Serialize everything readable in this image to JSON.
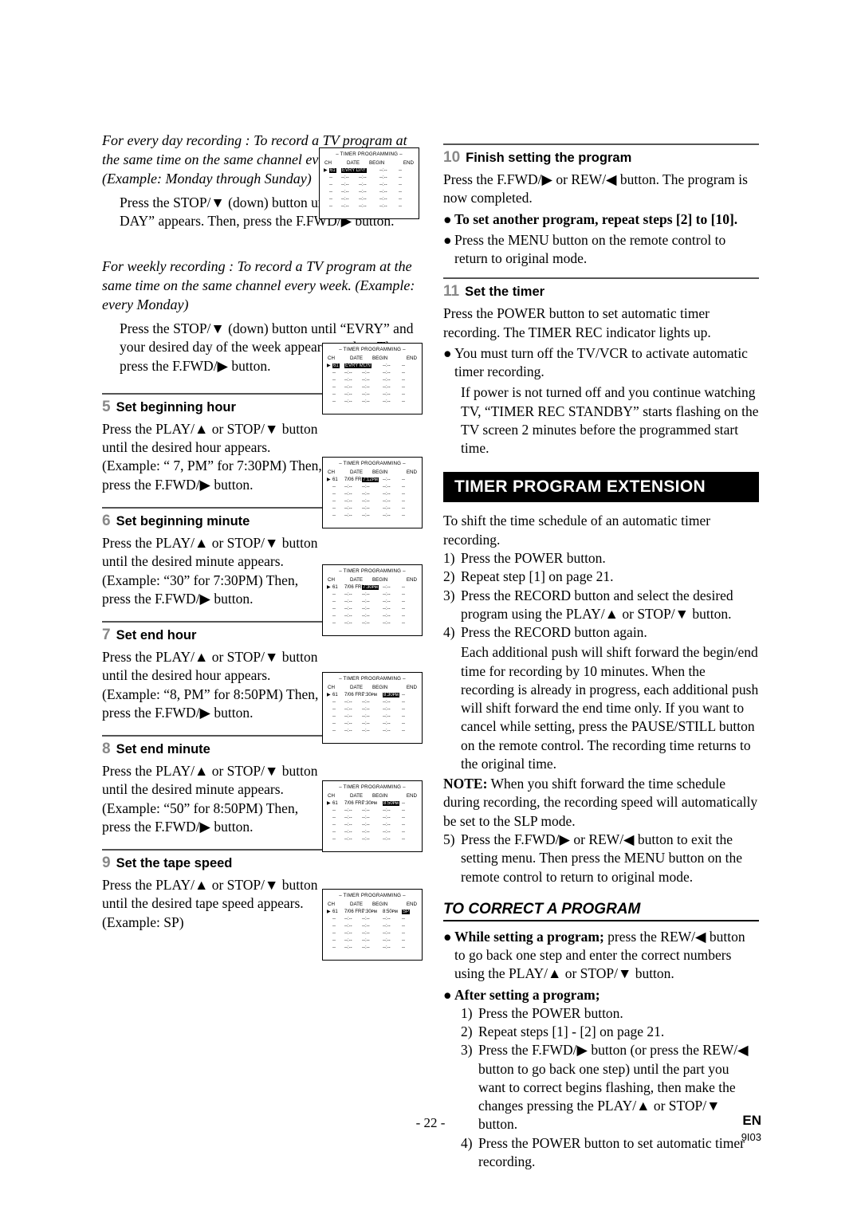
{
  "page": {
    "number": "- 22 -",
    "lang": "EN",
    "code": "9I03"
  },
  "left_column": {
    "everyday": {
      "heading_italic": "For every day recording : To record a TV program at the same time on the same channel every day. (Example: Monday through Sunday)",
      "body": "Press the STOP/▼ (down) button until “EVRY DAY” appears. Then, press the F.FWD/▶ button."
    },
    "weekly": {
      "heading_italic": "For weekly recording : To record a TV program at the same time on the same channel every week. (Example: every Monday)",
      "body": "Press the STOP/▼ (down) button until “EVRY” and your desired day of the week appear together. Then, press the F.FWD/▶ button."
    },
    "steps": [
      {
        "num": "5",
        "label": "Set beginning hour",
        "body": "Press the PLAY/▲ or STOP/▼ button until the desired hour appears. (Example: “ 7, PM” for 7:30PM) Then, press the F.FWD/▶ button."
      },
      {
        "num": "6",
        "label": "Set beginning minute",
        "body": "Press the PLAY/▲ or STOP/▼ button until the desired minute appears. (Example: “30” for 7:30PM) Then, press the F.FWD/▶ button."
      },
      {
        "num": "7",
        "label": "Set end hour",
        "body": "Press the PLAY/▲ or STOP/▼ button until the desired hour appears. (Example: “8, PM” for 8:50PM) Then, press the F.FWD/▶ button."
      },
      {
        "num": "8",
        "label": "Set end minute",
        "body": "Press the PLAY/▲ or STOP/▼ button until the desired minute appears. (Example: “50” for 8:50PM) Then, press the F.FWD/▶ button."
      },
      {
        "num": "9",
        "label": "Set the tape speed",
        "body": "Press the PLAY/▲ or STOP/▼ button until the desired tape speed appears. (Example: SP)"
      }
    ]
  },
  "osd_screens": {
    "title": "– TIMER PROGRAMMING –",
    "headers": [
      "CH",
      "DATE",
      "BEGIN",
      "END"
    ],
    "rows": [
      {
        "id": "everyday",
        "ch": "61",
        "date": "EVRY DAY",
        "begin": "--:--",
        "end": "--:--",
        "sp": "--"
      },
      {
        "id": "weekly",
        "ch": "61",
        "date": "EVRY MON",
        "begin": "--:--",
        "end": "--:--",
        "sp": "--"
      },
      {
        "id": "begin_hour",
        "ch": "61",
        "date": "7/06  FRI",
        "begin": "7:12ᴘᴍ",
        "end": "--:--",
        "sp": "--"
      },
      {
        "id": "begin_min",
        "ch": "61",
        "date": "7/06  FRI",
        "begin": "7:30ᴘᴍ",
        "end": "--:--",
        "sp": "--"
      },
      {
        "id": "end_hour",
        "ch": "61",
        "date": "7/06  FRI",
        "begin": "7:30ᴘᴍ",
        "end": "8:30ᴘᴍ",
        "sp": "--"
      },
      {
        "id": "end_min",
        "ch": "61",
        "date": "7/06  FRI",
        "begin": "7:30ᴘᴍ",
        "end": "8:50ᴘᴍ",
        "sp": "--"
      },
      {
        "id": "tape_speed",
        "ch": "61",
        "date": "7/06  FRI",
        "begin": "7:30ᴘᴍ",
        "end": "8:50ᴘᴍ",
        "sp": "SP"
      }
    ],
    "empty_cell": "--:--",
    "empty_short": "--"
  },
  "right_column": {
    "step10": {
      "num": "10",
      "label": "Finish setting the program",
      "body": "Press the F.FWD/▶ or REW/◀ button. The program is now completed.",
      "bullets": [
        {
          "bold": true,
          "text": "To set another program, repeat steps [2] to [10]."
        },
        {
          "bold": false,
          "text": "Press the MENU button on the remote control to return to original mode."
        }
      ]
    },
    "step11": {
      "num": "11",
      "label": "Set the timer",
      "body": "Press the POWER button to set automatic timer recording. The TIMER REC indicator lights up.",
      "bullets": [
        {
          "bold": false,
          "text": "You must turn off the TV/VCR to activate automatic timer recording."
        }
      ],
      "note": "If power is not turned off and you continue watching TV, “TIMER REC STANDBY” starts flashing on the TV screen 2 minutes before the programmed start time."
    },
    "timer_extension": {
      "title": "TIMER PROGRAM EXTENSION",
      "intro": "To shift the time schedule of an automatic timer recording.",
      "steps": [
        {
          "n": "1)",
          "t": "Press the POWER button."
        },
        {
          "n": "2)",
          "t": "Repeat step [1] on page 21."
        },
        {
          "n": "3)",
          "t": "Press the RECORD button and select the desired program using the PLAY/▲ or STOP/▼ button."
        },
        {
          "n": "4)",
          "t": "Press the RECORD button again."
        }
      ],
      "paragraph": "Each additional push will shift forward the begin/end time for recording by 10 minutes. When the recording is already in progress, each additional push will shift forward the end time only. If you want to cancel while setting, press the PAUSE/STILL button on the remote control. The recording time returns to the original time.",
      "note_label": "NOTE:",
      "note_text": " When you shift forward the time schedule during recording, the recording speed will automatically be set to the SLP mode.",
      "step5": {
        "n": "5)",
        "t": "Press the F.FWD/▶ or REW/◀ button to exit the setting menu. Then press the MENU button on the remote control to return to original mode."
      }
    },
    "correct_program": {
      "title": "TO CORRECT A PROGRAM",
      "bullet1_bold": "While setting a program;",
      "bullet1_rest": " press the REW/◀ button to go back one step and enter the correct numbers using the PLAY/▲ or STOP/▼ button.",
      "bullet2_bold": "After setting a program;",
      "steps": [
        {
          "n": "1)",
          "t": "Press the POWER button."
        },
        {
          "n": "2)",
          "t": "Repeat steps [1] - [2] on page 21."
        },
        {
          "n": "3)",
          "t": "Press the F.FWD/▶ button (or press the REW/◀ button to go back one step) until the part you want to correct begins flashing, then make the changes pressing the PLAY/▲ or STOP/▼ button."
        },
        {
          "n": "4)",
          "t": "Press the POWER button to set automatic timer recording."
        }
      ]
    }
  }
}
